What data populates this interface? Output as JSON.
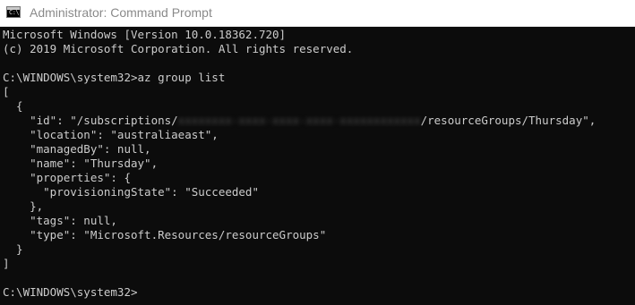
{
  "window": {
    "title": "Administrator: Command Prompt",
    "icon": "cmd-icon"
  },
  "console": {
    "banner_version": "Microsoft Windows [Version 10.0.18362.720]",
    "banner_copyright": "(c) 2019 Microsoft Corporation. All rights reserved.",
    "prompt_path": "C:\\WINDOWS\\system32>",
    "command": "az group list",
    "output": {
      "open_bracket": "[",
      "open_brace": "  {",
      "id_prefix": "    \"id\": \"/subscriptions/",
      "id_masked": "xxxxxxxx-xxxx-xxxx-xxxx-xxxxxxxxxxxx",
      "id_suffix": "/resourceGroups/Thursday\",",
      "location": "    \"location\": \"australiaeast\",",
      "managed_by": "    \"managedBy\": null,",
      "name": "    \"name\": \"Thursday\",",
      "properties_open": "    \"properties\": {",
      "provisioning_state": "      \"provisioningState\": \"Succeeded\"",
      "properties_close": "    },",
      "tags": "    \"tags\": null,",
      "type": "    \"type\": \"Microsoft.Resources/resourceGroups\"",
      "close_brace": "  }",
      "close_bracket": "]"
    }
  },
  "colors": {
    "console_background": "#0c0c0c",
    "console_text": "#cccccc",
    "titlebar_background": "#ffffff",
    "titlebar_text": "#8a8a8a"
  }
}
